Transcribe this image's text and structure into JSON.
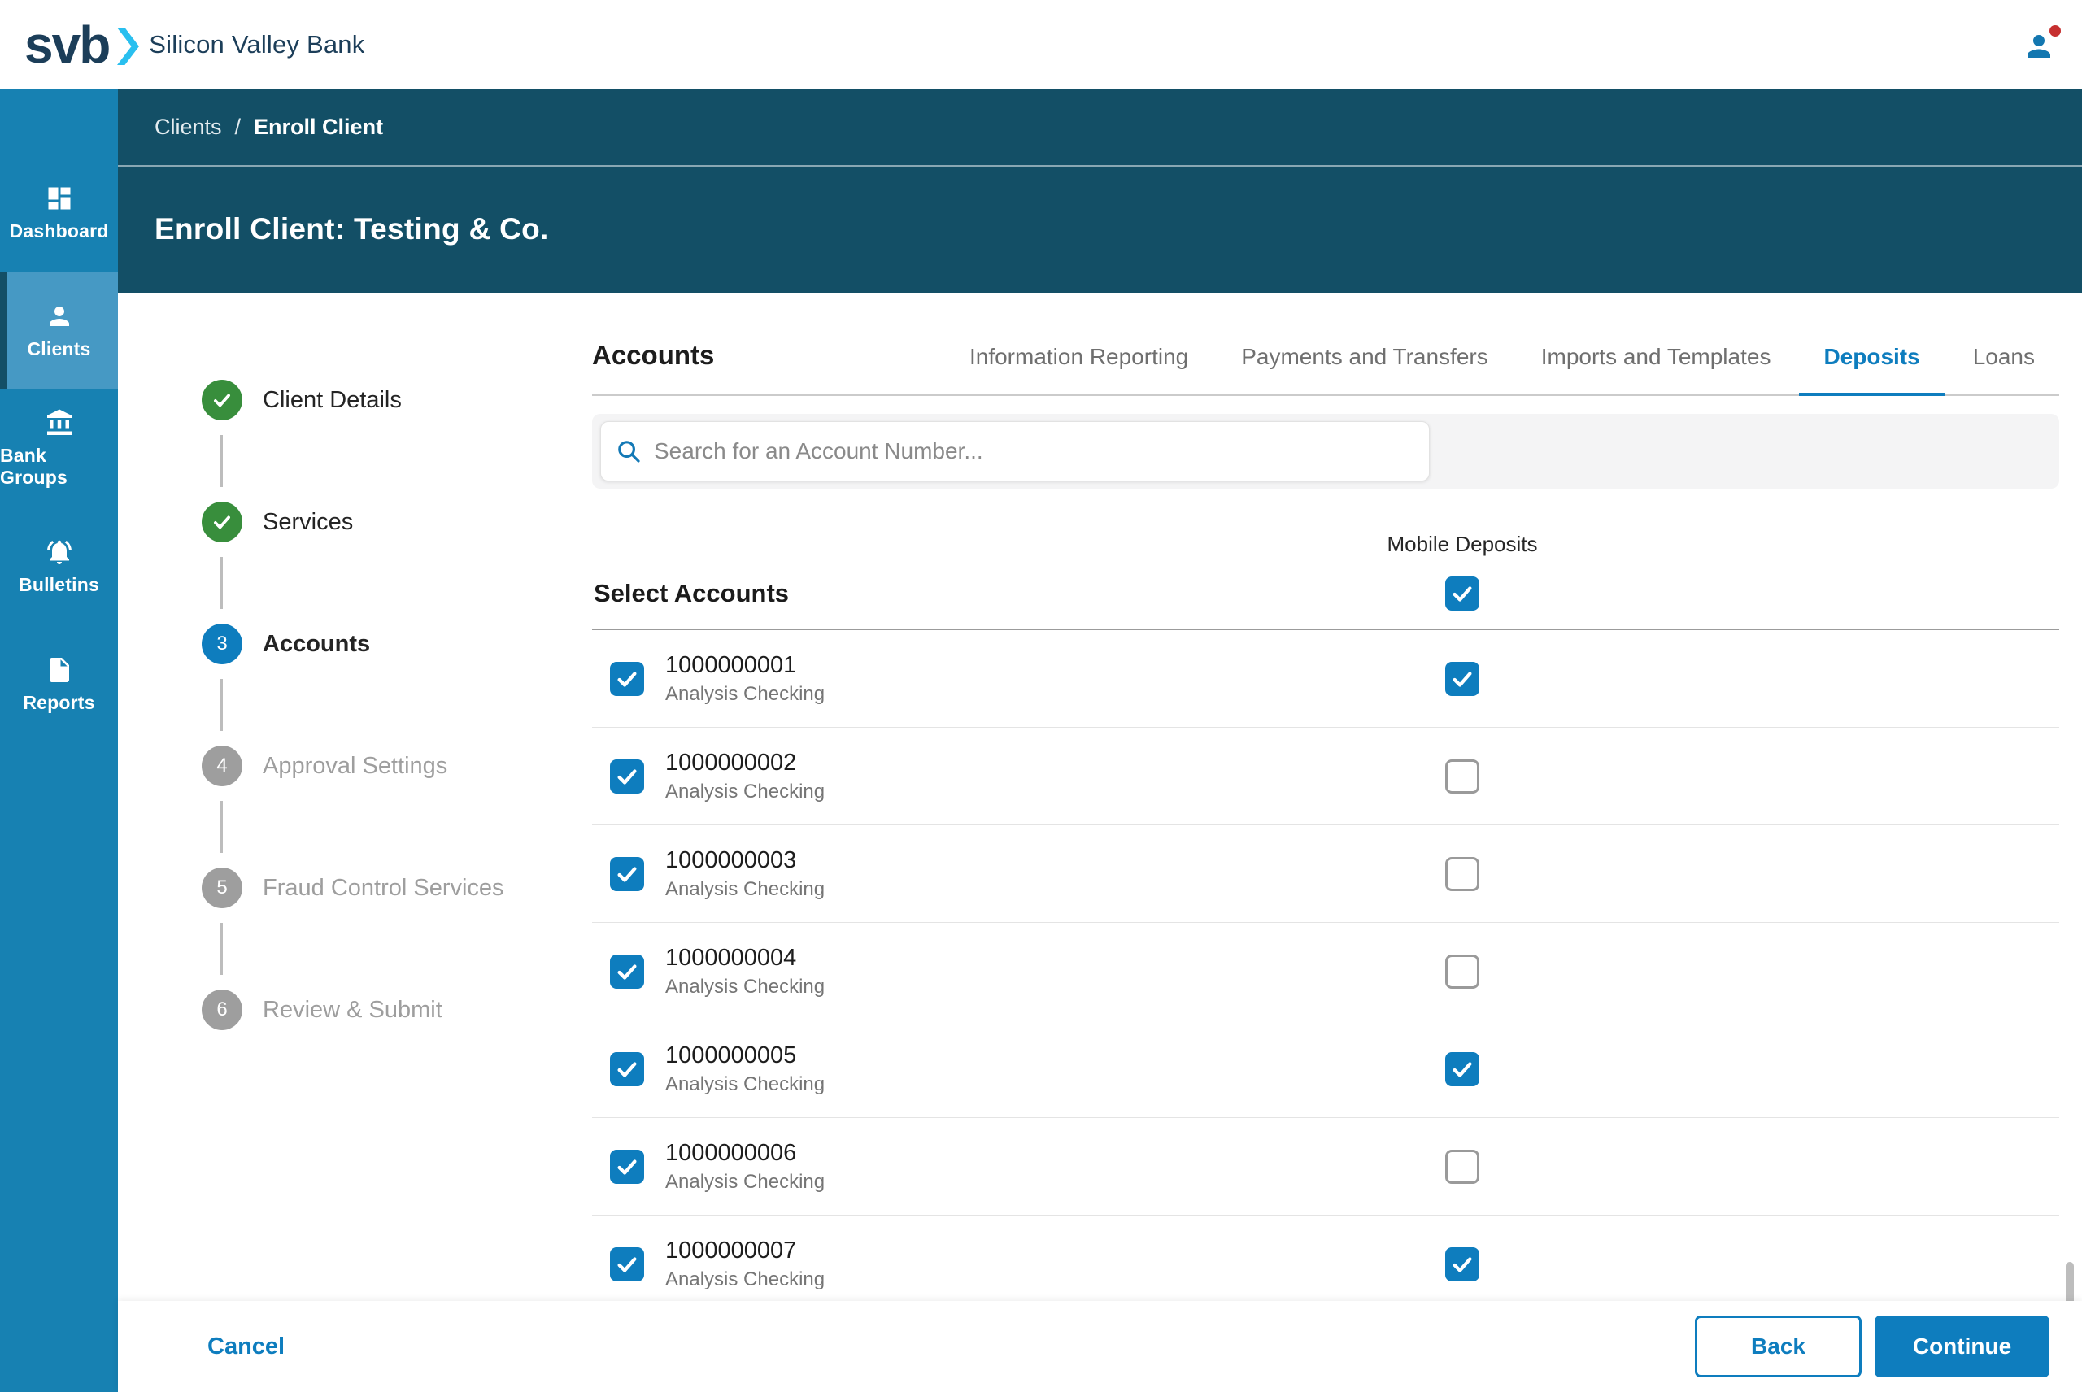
{
  "colors": {
    "brand_navy": "#1C3E59",
    "brand_cyan": "#29BFEF",
    "sidebar_blue": "#1781B2",
    "sidebar_active": "#4699C4",
    "header_teal": "#134F66",
    "accent_blue": "#0E7DBE",
    "success_green": "#388E3C",
    "inactive_gray": "#9E9E9E",
    "text_dark": "#202020",
    "text_gray": "#757575",
    "alert_red": "#C62F2F"
  },
  "topbar": {
    "logo_text": "svb",
    "brand_name": "Silicon Valley Bank"
  },
  "sidebar": {
    "items": [
      {
        "label": "Dashboard",
        "icon": "dashboard",
        "active": false
      },
      {
        "label": "Clients",
        "icon": "person",
        "active": true
      },
      {
        "label": "Bank Groups",
        "icon": "bank",
        "active": false
      },
      {
        "label": "Bulletins",
        "icon": "bell",
        "active": false
      },
      {
        "label": "Reports",
        "icon": "document",
        "active": false
      }
    ]
  },
  "header": {
    "breadcrumb_parent": "Clients",
    "breadcrumb_separator": "/",
    "breadcrumb_current": "Enroll Client",
    "title": "Enroll Client: Testing & Co."
  },
  "stepper": [
    {
      "num": 1,
      "label": "Client Details",
      "state": "done"
    },
    {
      "num": 2,
      "label": "Services",
      "state": "done"
    },
    {
      "num": 3,
      "label": "Accounts",
      "state": "active"
    },
    {
      "num": 4,
      "label": "Approval Settings",
      "state": "todo"
    },
    {
      "num": 5,
      "label": "Fraud Control Services",
      "state": "todo"
    },
    {
      "num": 6,
      "label": "Review & Submit",
      "state": "todo"
    }
  ],
  "content": {
    "heading": "Accounts",
    "tabs": [
      {
        "label": "Information Reporting",
        "active": false
      },
      {
        "label": "Payments and Transfers",
        "active": false
      },
      {
        "label": "Imports and Templates",
        "active": false
      },
      {
        "label": "Deposits",
        "active": true
      },
      {
        "label": "Loans",
        "active": false
      }
    ],
    "search_placeholder": "Search for an Account Number...",
    "column_header": "Mobile Deposits",
    "select_accounts_label": "Select Accounts",
    "master_checkbox_checked": true,
    "accounts": [
      {
        "number": "1000000001",
        "type": "Analysis Checking",
        "selected": true,
        "mobile_deposits": true
      },
      {
        "number": "1000000002",
        "type": "Analysis Checking",
        "selected": true,
        "mobile_deposits": false
      },
      {
        "number": "1000000003",
        "type": "Analysis Checking",
        "selected": true,
        "mobile_deposits": false
      },
      {
        "number": "1000000004",
        "type": "Analysis Checking",
        "selected": true,
        "mobile_deposits": false
      },
      {
        "number": "1000000005",
        "type": "Analysis Checking",
        "selected": true,
        "mobile_deposits": true
      },
      {
        "number": "1000000006",
        "type": "Analysis Checking",
        "selected": true,
        "mobile_deposits": false
      },
      {
        "number": "1000000007",
        "type": "Analysis Checking",
        "selected": true,
        "mobile_deposits": true
      }
    ]
  },
  "footer": {
    "cancel": "Cancel",
    "back": "Back",
    "continue": "Continue"
  }
}
